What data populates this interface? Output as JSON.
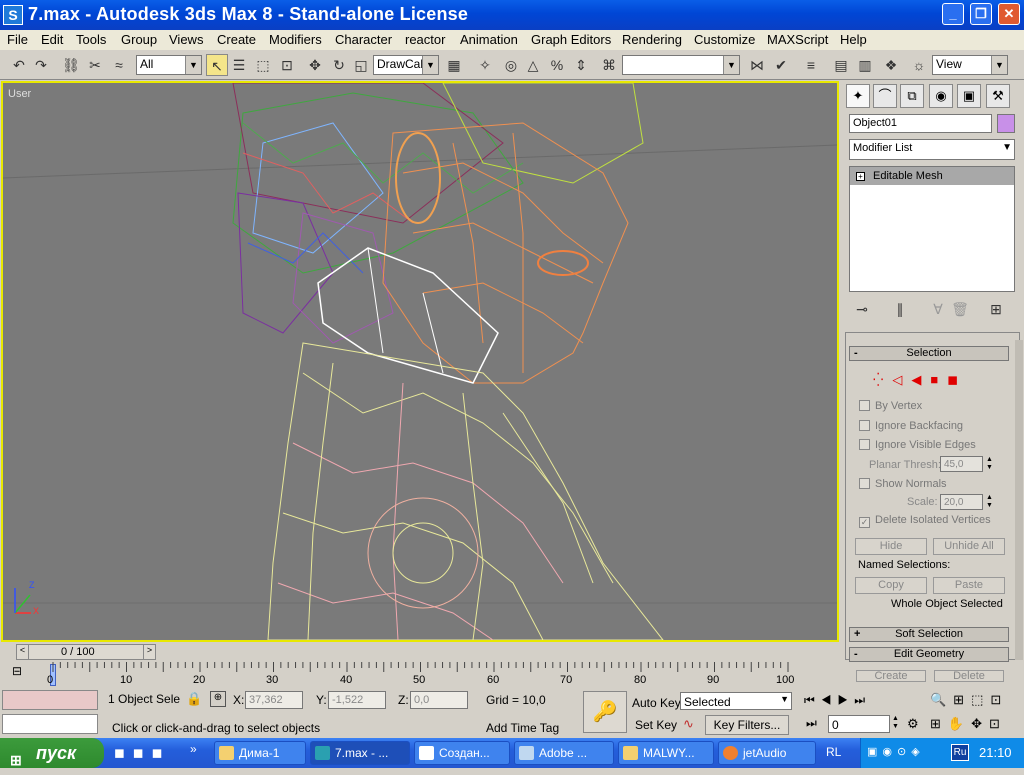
{
  "window": {
    "title": "7.max - Autodesk 3ds Max 8  - Stand-alone License",
    "app_icon": "S"
  },
  "menu": [
    "File",
    "Edit",
    "Tools",
    "Group",
    "Views",
    "Create",
    "Modifiers",
    "Character",
    "reactor",
    "Animation",
    "Graph Editors",
    "Rendering",
    "Customize",
    "MAXScript",
    "Help"
  ],
  "toolbar": {
    "selection_filter": "All",
    "named_selection": "DrawCall",
    "reference_coord": "View"
  },
  "viewport": {
    "label": "User",
    "axis_z": "Z",
    "axis_x": "X"
  },
  "command_panel": {
    "object_name": "Object01",
    "object_color": "#c890e8",
    "modifier_list": "Modifier List",
    "stack_item": "Editable Mesh",
    "selection_rollout": {
      "title": "Selection",
      "by_vertex": "By Vertex",
      "ignore_backfacing": "Ignore Backfacing",
      "ignore_visible_edges": "Ignore Visible Edges",
      "planar_thresh_label": "Planar Thresh:",
      "planar_thresh_value": "45,0",
      "show_normals": "Show Normals",
      "scale_label": "Scale:",
      "scale_value": "20,0",
      "delete_isolated": "Delete Isolated Vertices",
      "hide": "Hide",
      "unhide_all": "Unhide All",
      "named_selections": "Named Selections:",
      "copy": "Copy",
      "paste": "Paste",
      "status": "Whole Object Selected"
    },
    "soft_selection": "Soft Selection",
    "edit_geometry": "Edit Geometry",
    "create": "Create",
    "delete": "Delete"
  },
  "time": {
    "slider": "0 / 100",
    "ticks": [
      "0",
      "10",
      "20",
      "30",
      "40",
      "50",
      "60",
      "70",
      "80",
      "90",
      "100"
    ]
  },
  "status": {
    "selection_count": "1 Object Sele",
    "x_label": "X:",
    "x_value": "37,362",
    "y_label": "Y:",
    "y_value": "-1,522",
    "z_label": "Z:",
    "z_value": "0,0",
    "grid": "Grid = 10,0",
    "prompt": "Click or click-and-drag to select objects",
    "add_time_tag": "Add Time Tag",
    "auto_key": "Auto Key",
    "set_key": "Set Key",
    "key_mode": "Selected",
    "key_filters": "Key Filters...",
    "frame": "0"
  },
  "taskbar": {
    "start": "пуск",
    "tasks": [
      "Дима-1",
      "7.max - ...",
      "Создан...",
      "Adobe ...",
      "MALWY...",
      "jetAudio"
    ],
    "lang": "RL",
    "tray_lang": "Ru",
    "clock": "21:10"
  }
}
